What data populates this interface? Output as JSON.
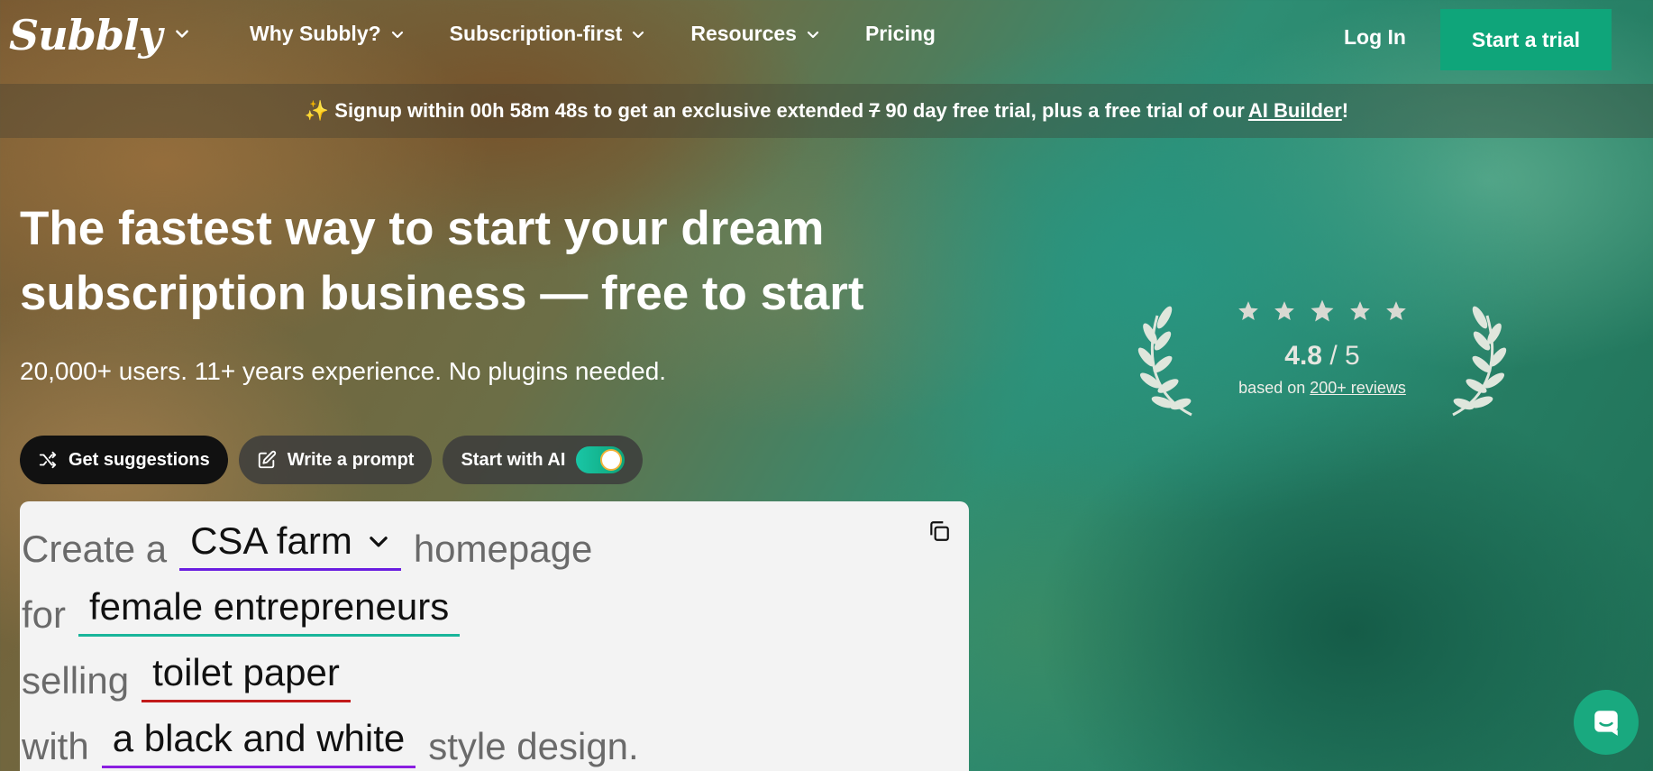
{
  "nav": {
    "logo": "Subbly",
    "links": [
      {
        "label": "Why Subbly?",
        "dropdown": true
      },
      {
        "label": "Subscription-first",
        "dropdown": true
      },
      {
        "label": "Resources",
        "dropdown": true
      },
      {
        "label": "Pricing",
        "dropdown": false
      }
    ],
    "login": "Log In",
    "cta": "Start a trial"
  },
  "banner": {
    "sparkle": "✨",
    "text1": "Signup within 00h 58m 48s to get an exclusive extended",
    "old_days": "7",
    "new_days": "90",
    "text2": "day free trial, plus a free trial of our",
    "link": "AI Builder",
    "end": "!"
  },
  "hero": {
    "title_line1": "The fastest way to start your dream",
    "title_line2": "subscription business — free to start",
    "subtitle": "20,000+ users. 11+ years experience. No plugins needed."
  },
  "pills": {
    "suggestions": "Get suggestions",
    "prompt": "Write a prompt",
    "ai": "Start with AI",
    "ai_toggle_on": true
  },
  "prompt_card": {
    "line1_pre": "Create a",
    "business_type": "CSA farm",
    "line1_post": "homepage",
    "line2_pre": "for",
    "audience": "female entrepreneurs",
    "line3_pre": "selling",
    "product": "toilet paper",
    "line4_pre": "with",
    "style": "a black and white",
    "line4_post": "style design."
  },
  "rating": {
    "stars": 5,
    "score": "4.8",
    "out_of": " / 5",
    "based_on": "based on",
    "reviews_link": "200+ reviews"
  },
  "colors": {
    "accent": "#0fa57a",
    "slot_business": "#6a1ee0",
    "slot_audience": "#19b59a",
    "slot_product": "#c21a1a",
    "slot_style": "#8a1ee0"
  }
}
